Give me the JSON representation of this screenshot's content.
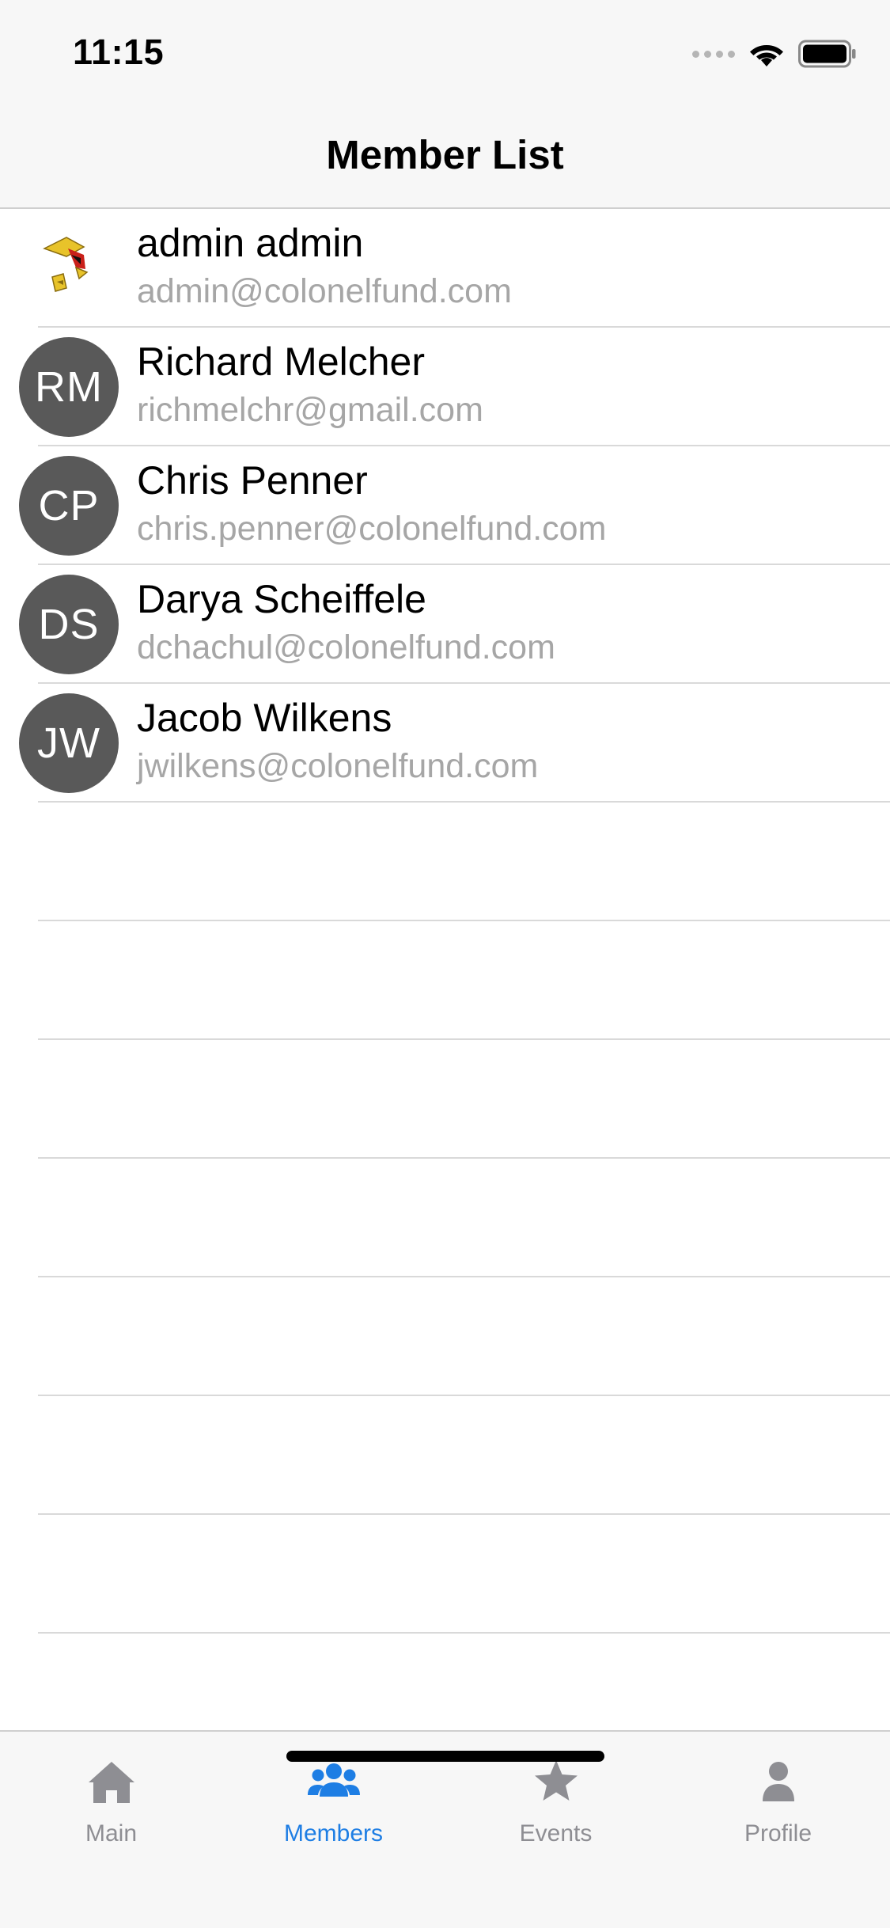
{
  "status_bar": {
    "time": "11:15"
  },
  "nav": {
    "title": "Member List"
  },
  "members": [
    {
      "name": "admin admin",
      "email": "admin@colonelfund.com",
      "initials": "",
      "avatar": "logo-icon"
    },
    {
      "name": "Richard Melcher",
      "email": "richmelchr@gmail.com",
      "initials": "RM"
    },
    {
      "name": "Chris Penner",
      "email": "chris.penner@colonelfund.com",
      "initials": "CP"
    },
    {
      "name": "Darya Scheiffele",
      "email": "dchachul@colonelfund.com",
      "initials": "DS"
    },
    {
      "name": "Jacob Wilkens",
      "email": "jwilkens@colonelfund.com",
      "initials": "JW"
    }
  ],
  "tab_bar": {
    "tabs": [
      {
        "label": "Main",
        "icon": "home-icon",
        "active": false
      },
      {
        "label": "Members",
        "icon": "people-icon",
        "active": true
      },
      {
        "label": "Events",
        "icon": "star-icon",
        "active": false
      },
      {
        "label": "Profile",
        "icon": "person-icon",
        "active": false
      }
    ]
  },
  "colors": {
    "accent": "#1e7ee4",
    "inactive_tab": "#8e8e93",
    "avatar_bg": "#595959",
    "secondary_text": "#a6a6a6",
    "bar_bg": "#f7f7f7"
  }
}
